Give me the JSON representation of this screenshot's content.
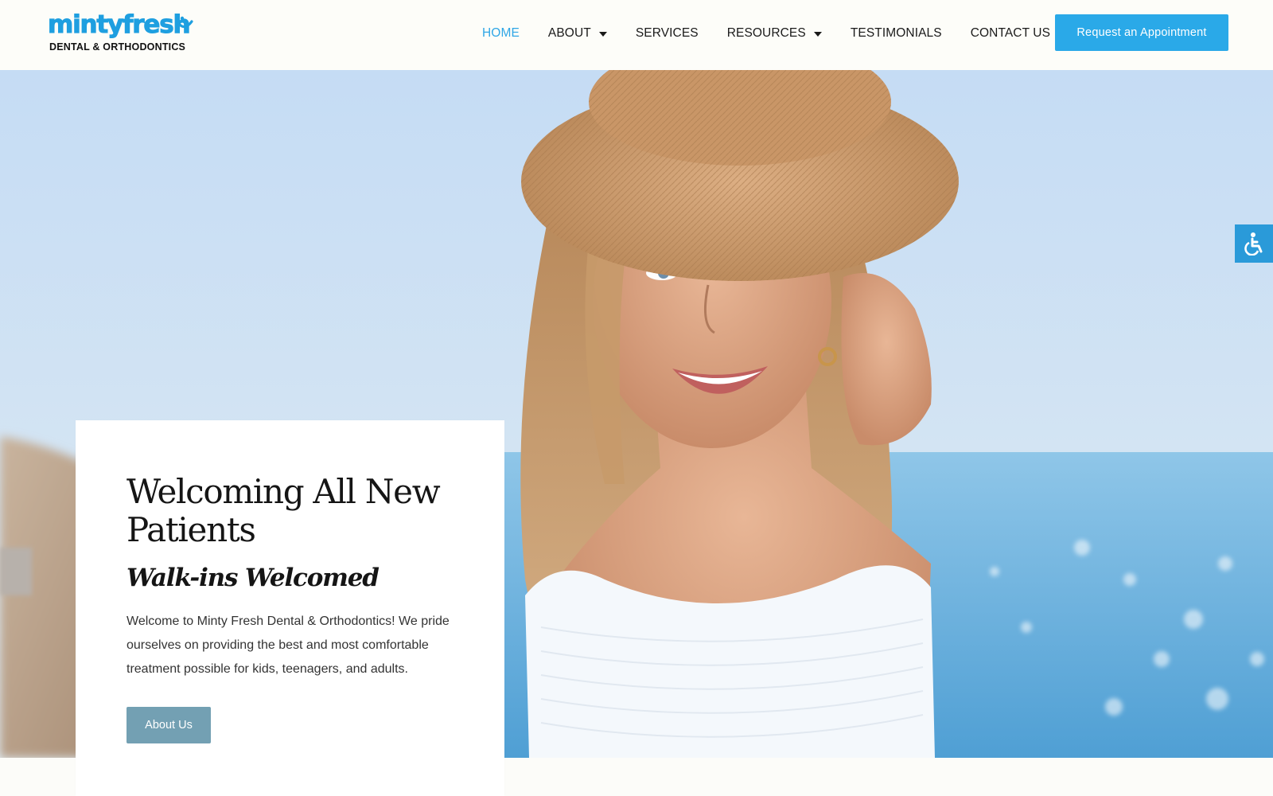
{
  "brand": {
    "logo_top": "mintyfresh",
    "logo_bottom": "DENTAL & ORTHODONTICS",
    "color": "#1e9fe0"
  },
  "nav": {
    "items": [
      {
        "label": "HOME",
        "active": true,
        "dropdown": false
      },
      {
        "label": "ABOUT",
        "active": false,
        "dropdown": true
      },
      {
        "label": "SERVICES",
        "active": false,
        "dropdown": false
      },
      {
        "label": "RESOURCES",
        "active": false,
        "dropdown": true
      },
      {
        "label": "TESTIMONIALS",
        "active": false,
        "dropdown": false
      },
      {
        "label": "CONTACT US",
        "active": false,
        "dropdown": false
      }
    ],
    "active_color": "#2fa6e6"
  },
  "header": {
    "cta_label": "Request an Appointment",
    "cta_color": "#2aa9e8"
  },
  "hero": {
    "image_icon": "smiling-woman-straw-hat-beach-photo",
    "accessibility_icon": "wheelchair-icon",
    "accessibility_color": "#2a9ad9"
  },
  "card": {
    "title": "Welcoming All New Patients",
    "subtitle": "Walk-ins Welcomed",
    "text": "Welcome to Minty Fresh Dental & Orthodontics! We pride ourselves on providing the best and most comfortable treatment possible for kids, teenagers, and adults.",
    "button_label": "About Us",
    "button_color": "#73a0b3"
  }
}
